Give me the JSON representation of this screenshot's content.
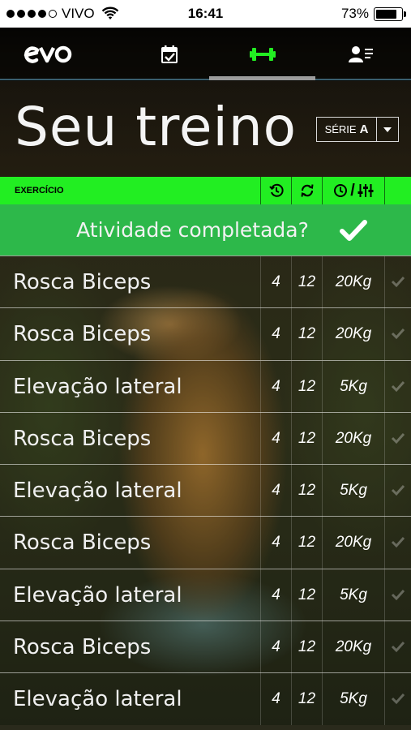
{
  "status_bar": {
    "carrier": "VIVO",
    "time": "16:41",
    "battery": "73%",
    "signal_bars": 4,
    "signal_total": 5,
    "battery_level": 0.73
  },
  "nav": {
    "logo": "evo",
    "items": [
      "calendar-check-icon",
      "dumbbell-icon",
      "profile-list-icon"
    ],
    "active": "dumbbell-icon",
    "active_color": "#22ee22"
  },
  "page": {
    "title": "Seu treino",
    "series_label": "SÉRIE",
    "series_value": "A"
  },
  "table_header": {
    "exercise": "EXERCÍCIO",
    "slash": "/",
    "icons": [
      "clock-icon",
      "refresh-icon",
      "clock-icon",
      "sliders-icon"
    ],
    "color": "#22ee22"
  },
  "completion": {
    "question": "Atividade completada?",
    "color": "#2db84a"
  },
  "exercises": [
    {
      "name": "Rosca Biceps",
      "sets": "4",
      "reps": "12",
      "load": "20Kg"
    },
    {
      "name": "Rosca Biceps",
      "sets": "4",
      "reps": "12",
      "load": "20Kg"
    },
    {
      "name": "Elevação lateral",
      "sets": "4",
      "reps": "12",
      "load": "5Kg"
    },
    {
      "name": "Rosca Biceps",
      "sets": "4",
      "reps": "12",
      "load": "20Kg"
    },
    {
      "name": "Elevação lateral",
      "sets": "4",
      "reps": "12",
      "load": "5Kg"
    },
    {
      "name": "Rosca Biceps",
      "sets": "4",
      "reps": "12",
      "load": "20Kg"
    },
    {
      "name": "Elevação lateral",
      "sets": "4",
      "reps": "12",
      "load": "5Kg"
    },
    {
      "name": "Rosca Biceps",
      "sets": "4",
      "reps": "12",
      "load": "20Kg"
    },
    {
      "name": "Elevação lateral",
      "sets": "4",
      "reps": "12",
      "load": "5Kg"
    }
  ]
}
